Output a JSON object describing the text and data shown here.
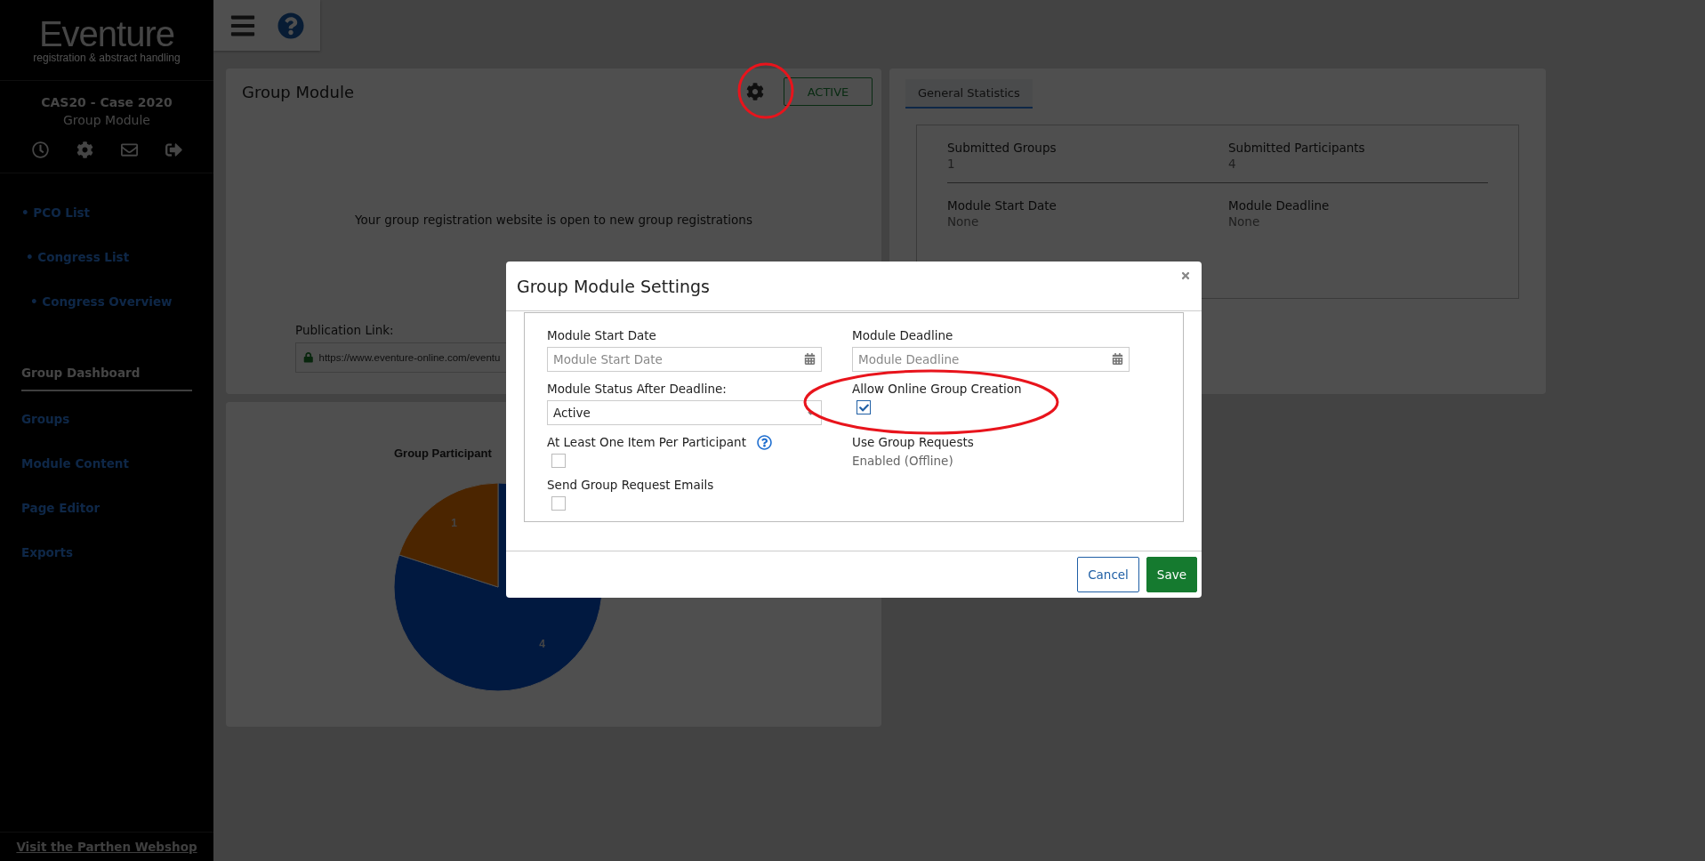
{
  "sidebar": {
    "logo": {
      "name": "Eventure",
      "tagline": "registration & abstract handling"
    },
    "event": {
      "code": "CAS20 - Case 2020",
      "module": "Group Module"
    },
    "breadcrumbs": [
      {
        "label": "• PCO List",
        "children": [
          {
            "label": "• Congress List",
            "children": [
              {
                "label": "• Congress Overview"
              }
            ]
          }
        ]
      }
    ],
    "menu": [
      {
        "label": "Group Dashboard",
        "selected": true
      },
      {
        "label": "Groups",
        "selected": false
      },
      {
        "label": "Module Content",
        "selected": false
      },
      {
        "label": "Page Editor",
        "selected": false
      },
      {
        "label": "Exports",
        "selected": false
      }
    ],
    "footer_link": "Visit the Parthen Webshop"
  },
  "module_card": {
    "title": "Group Module",
    "status": "ACTIVE",
    "message": "Your group registration website is open to new group registrations",
    "publication_label": "Publication Link:",
    "publication_url": "https://www.eventure-online.com/eventu"
  },
  "chart_card": {
    "chart_data": {
      "type": "pie",
      "title": "Group Participant",
      "values": [
        4,
        1
      ],
      "data_labels": true
    }
  },
  "stats_card": {
    "tabs": [
      {
        "label": "General Statistics",
        "selected": true
      }
    ],
    "stats": [
      {
        "label": "Submitted Groups",
        "value": "1"
      },
      {
        "label": "Submitted Participants",
        "value": "4"
      },
      {
        "label": "Module Start Date",
        "value": "None"
      },
      {
        "label": "Module Deadline",
        "value": "None"
      }
    ]
  },
  "dialog": {
    "title": "Group Module Settings",
    "fields": [
      {
        "kind": "date",
        "label": "Module Start Date",
        "placeholder": "Module Start Date"
      },
      {
        "kind": "date",
        "label": "Module Deadline",
        "placeholder": "Module Deadline"
      },
      {
        "kind": "select",
        "label": "Module Status After Deadline:",
        "value": "Active"
      },
      {
        "kind": "checkbox",
        "label": "Allow Online Group Creation",
        "checked": true,
        "highlighted": true
      },
      {
        "kind": "checkbox",
        "label": "At Least One Item Per Participant",
        "checked": false,
        "help": true
      },
      {
        "kind": "info",
        "label": "Use Group Requests",
        "value": "Enabled (Offline)"
      },
      {
        "kind": "checkbox",
        "label": "Send Group Request Emails",
        "checked": false
      }
    ],
    "buttons": [
      {
        "kind": "secondary",
        "label": "Cancel"
      },
      {
        "kind": "primary",
        "label": "Save"
      }
    ]
  }
}
